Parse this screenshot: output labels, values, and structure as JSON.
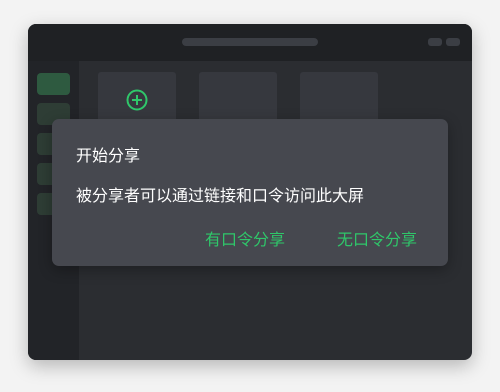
{
  "dialog": {
    "title": "开始分享",
    "message": "被分享者可以通过链接和口令访问此大屏",
    "button_with_code": "有口令分享",
    "button_without_code": "无口令分享"
  },
  "icons": {
    "add": "plus-circle-icon"
  },
  "colors": {
    "accent": "#2fc76a",
    "dialog_bg": "#46484f",
    "window_bg": "#2b2d31"
  }
}
